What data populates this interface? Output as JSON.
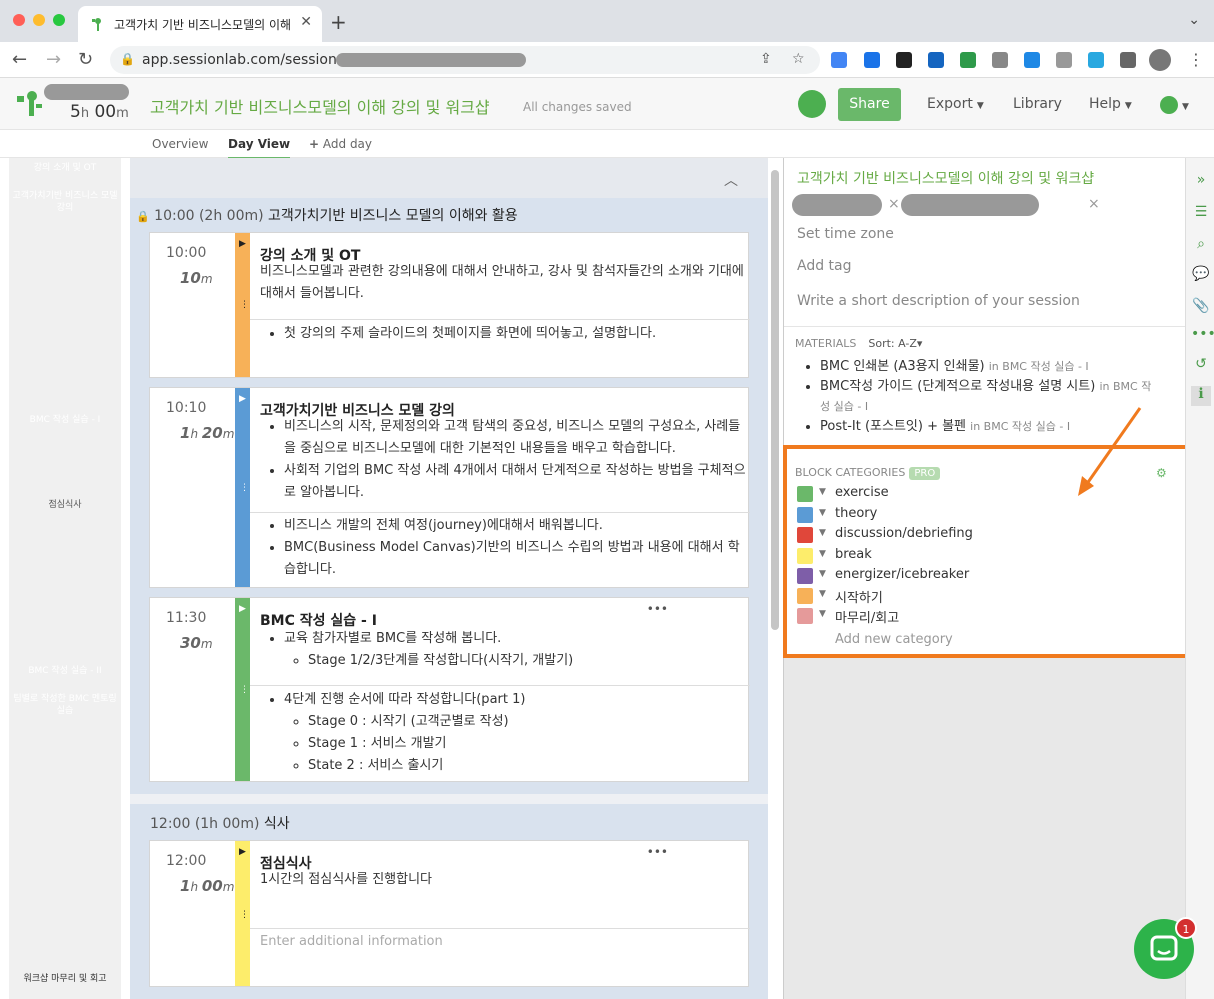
{
  "browser": {
    "tab_title": "고객가치 기반 비즈니스모델의 이해 강",
    "url": "app.sessionlab.com/sessions/"
  },
  "header": {
    "duration_h": "5",
    "duration_m": "00",
    "session_title": "고객가치 기반 비즈니스모델의 이해 강의 및 워크샵",
    "saved_status": "All changes saved",
    "share_label": "Share",
    "export_label": "Export",
    "library_label": "Library",
    "help_label": "Help"
  },
  "subnav": {
    "overview": "Overview",
    "day_view": "Day View",
    "add_day": "Add day"
  },
  "timeline": [
    {
      "label": "강의 소개 및 OT",
      "color": "#f7b158"
    },
    {
      "label": "고객가치기반 비즈니스 모델 강의",
      "color": "#5b9bd5"
    },
    {
      "label": "BMC 작성 실습 - I",
      "color": "#6bb86a"
    },
    {
      "label": "점심식사",
      "color": "#fded6b"
    },
    {
      "label": "BMC 작성 실습 - II",
      "color": "#6bb86a"
    },
    {
      "label": "팀별로 작성한 BMC 멘토링 실습",
      "color": "#d9553b"
    },
    {
      "label": "워크샵 마무리 및 회고",
      "color": "#e59a9a"
    }
  ],
  "groups": [
    {
      "time": "10:00",
      "duration": "(2h 00m)",
      "title": "고객가치기반 비즈니스 모델의 이해와 활용"
    },
    {
      "time": "12:00",
      "duration": "(1h 00m)",
      "title": "식사"
    }
  ],
  "cards": [
    {
      "time": "10:00",
      "dur_h": "",
      "dur_m": "10",
      "color": "#f7b158",
      "title": "강의 소개 및 OT",
      "description": "비즈니스모델과 관련한 강의내용에 대해서 안내하고, 강사 및 참석자들간의 소개와 기대에 대해서 들어봅니다.",
      "notes": [
        "첫 강의의 주제 슬라이드의 첫페이지를 화면에 띄어놓고, 설명합니다."
      ]
    },
    {
      "time": "10:10",
      "dur_h": "1",
      "dur_m": "20",
      "color": "#5b9bd5",
      "title": "고객가치기반 비즈니스 모델 강의",
      "description_items": [
        "비즈니스의 시작, 문제정의와 고객 탐색의 중요성, 비즈니스 모델의 구성요소, 사례들을 중심으로 비즈니스모델에 대한 기본적인 내용들을 배우고 학습합니다.",
        "사회적 기업의 BMC 작성 사례 4개에서 대해서 단계적으로 작성하는 방법을 구체적으로 알아봅니다."
      ],
      "notes": [
        "비즈니스 개발의 전체 여정(journey)에대해서 배워봅니다.",
        "BMC(Business Model Canvas)기반의 비즈니스 수립의 방법과 내용에 대해서 학습합니다."
      ]
    },
    {
      "time": "11:30",
      "dur_h": "",
      "dur_m": "30",
      "color": "#6bb86a",
      "title": "BMC 작성 실습 - I",
      "description_item": "교육 참가자별로 BMC를 작성해 봅니다.",
      "description_sub": "Stage 1/2/3단계를 작성합니다(시작기, 개발기)",
      "notes_item": "4단계 진행 순서에 따라 작성합니다(part 1)",
      "notes_sub": [
        "Stage 0 : 시작기 (고객군별로 작성)",
        "Stage 1 : 서비스 개발기",
        "State 2 : 서비스 출시기"
      ]
    },
    {
      "time": "12:00",
      "dur_h": "1",
      "dur_m": "00",
      "color": "#fded6b",
      "title": "점심식사",
      "description": "1시간의 점심식사를 진행합니다",
      "notes_placeholder": "Enter additional information"
    }
  ],
  "right_panel": {
    "title": "고객가치 기반 비즈니스모델의 이해 강의 및 워크샵",
    "set_time_zone": "Set time zone",
    "add_tag": "Add tag",
    "description_placeholder": "Write a short description of your session",
    "materials_label": "MATERIALS",
    "sort_label": "Sort: A-Z",
    "materials": [
      {
        "name": "BMC 인쇄본 (A3용지 인쇄물)",
        "in": "in BMC 작성 실습 - I"
      },
      {
        "name": "BMC작성 가이드 (단계적으로 작성내용 설명 시트)",
        "in": "in BMC 작성 실습 - I"
      },
      {
        "name": "Post-It (포스트잇) + 볼펜",
        "in": "in BMC 작성 실습 - I"
      }
    ],
    "block_categories_label": "BLOCK CATEGORIES",
    "pro_label": "PRO",
    "categories": [
      {
        "name": "exercise",
        "color": "#6bb86a"
      },
      {
        "name": "theory",
        "color": "#5b9bd5"
      },
      {
        "name": "discussion/debriefing",
        "color": "#e0473a"
      },
      {
        "name": "break",
        "color": "#fded6b"
      },
      {
        "name": "energizer/icebreaker",
        "color": "#7e5ea8"
      },
      {
        "name": "시작하기",
        "color": "#f7b158"
      },
      {
        "name": "마무리/회고",
        "color": "#e59a9a"
      }
    ],
    "add_category": "Add new category"
  },
  "chat_badge": "1"
}
